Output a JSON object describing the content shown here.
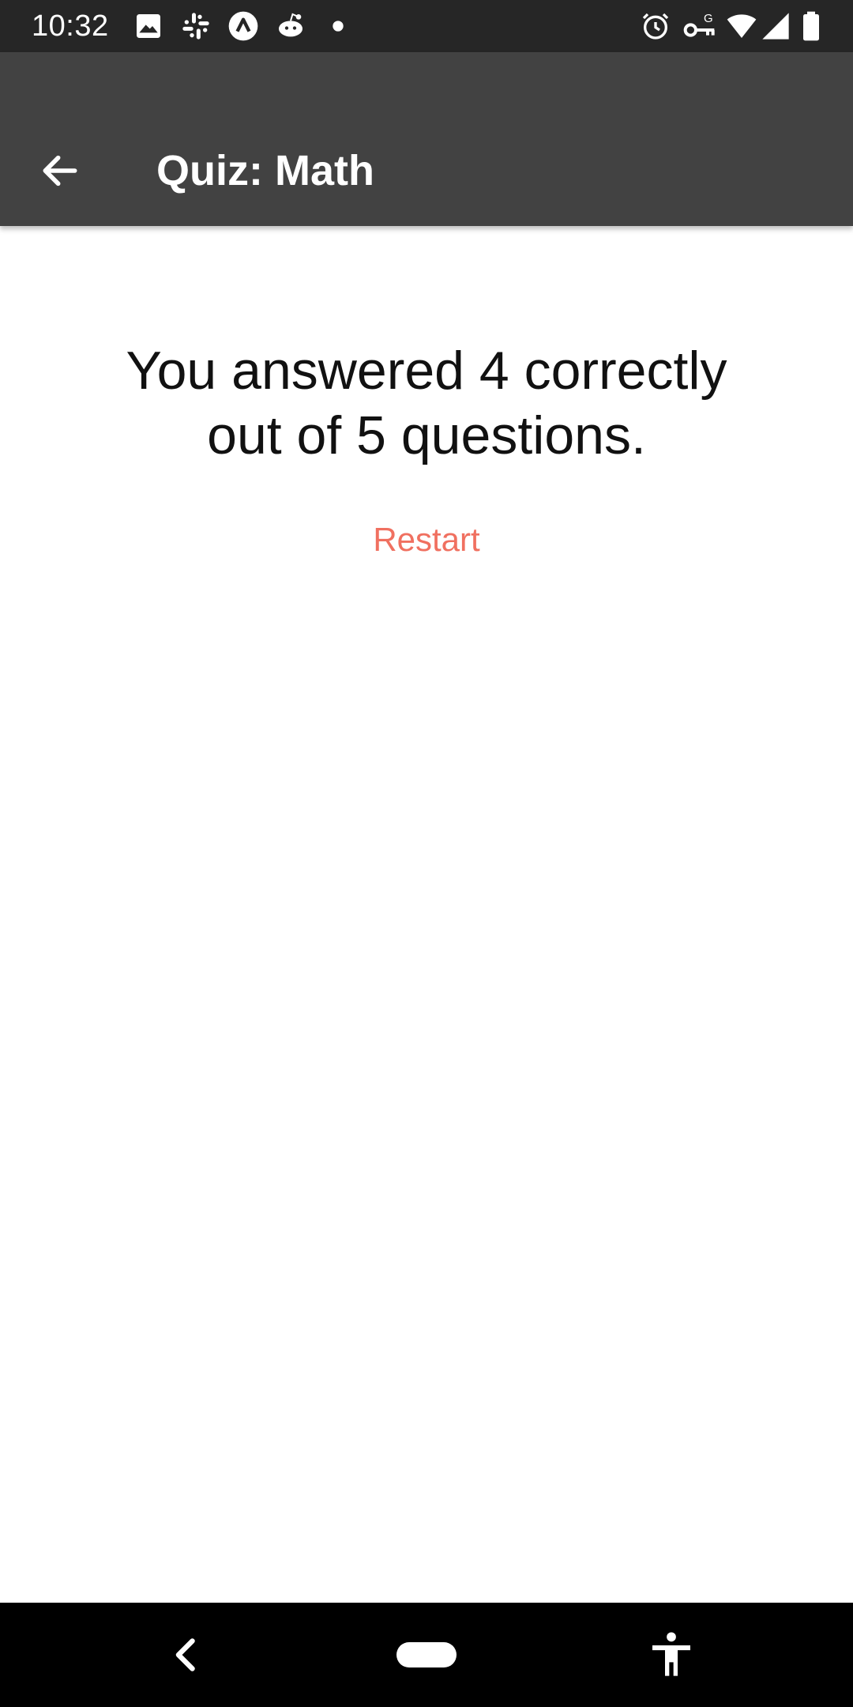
{
  "status_bar": {
    "time": "10:32",
    "left_icons": [
      "image-icon",
      "slack-icon",
      "arc-icon",
      "reddit-icon",
      "dot-icon"
    ],
    "right_icons": [
      "alarm-icon",
      "vpn-key-icon",
      "wifi-icon",
      "signal-icon",
      "battery-icon"
    ]
  },
  "app_bar": {
    "title": "Quiz: Math",
    "back_icon": "arrow-back-icon"
  },
  "result": {
    "line1": "You answered 4 correctly",
    "line2": "out of 5 questions."
  },
  "restart": {
    "label": "Restart",
    "color": "#f07060"
  },
  "nav_bar": {
    "icons": [
      "nav-back-icon",
      "home-pill-icon",
      "accessibility-icon"
    ]
  },
  "colors": {
    "status_bar_bg": "#262626",
    "app_bar_bg": "#424242",
    "accent": "#f07060"
  }
}
